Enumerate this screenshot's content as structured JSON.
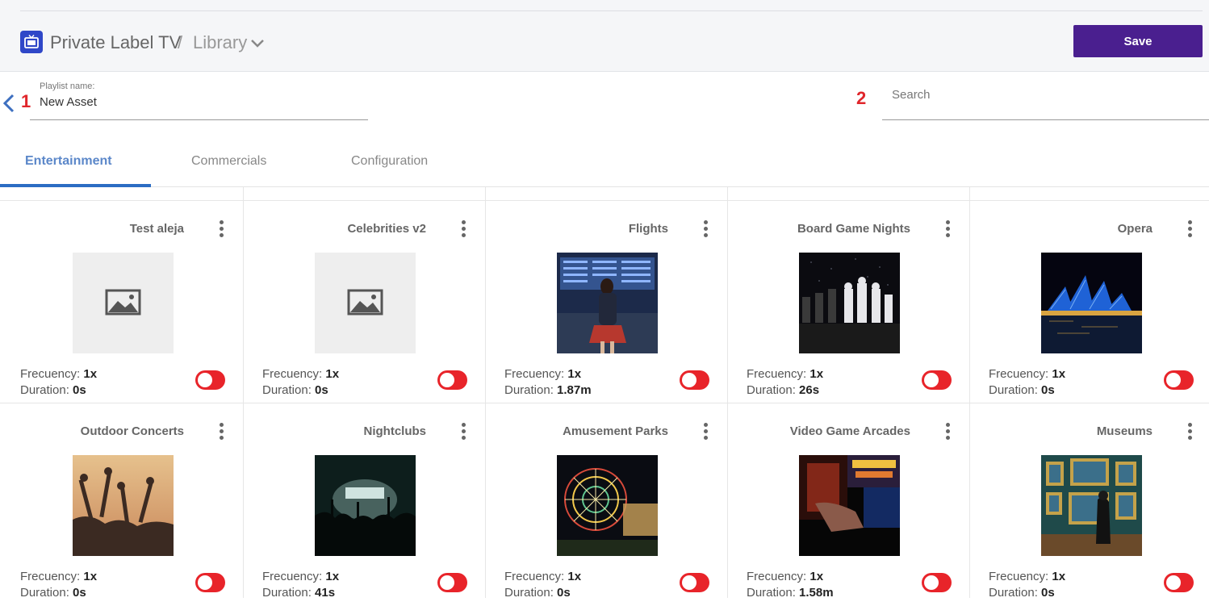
{
  "header": {
    "app_name": "Private Label TV",
    "separator": "/",
    "section": "Library",
    "save_label": "Save",
    "app_icon": "tv-icon",
    "brand_color": "#4a1f8f"
  },
  "playlist": {
    "label": "Playlist name:",
    "value": "New Asset",
    "marker1": "1",
    "marker2": "2",
    "search_placeholder": "Search"
  },
  "tabs": [
    {
      "label": "Entertainment",
      "active": true
    },
    {
      "label": "Commercials",
      "active": false
    },
    {
      "label": "Configuration",
      "active": false
    }
  ],
  "meta_labels": {
    "frequency": "Frecuency:",
    "duration": "Duration:"
  },
  "cards": [
    {
      "title": "Test aleja",
      "frequency": "1x",
      "duration": "0s",
      "thumb": "placeholder",
      "enabled": false
    },
    {
      "title": "Celebrities v2",
      "frequency": "1x",
      "duration": "0s",
      "thumb": "placeholder",
      "enabled": false
    },
    {
      "title": "Flights",
      "frequency": "1x",
      "duration": "1.87m",
      "thumb": "flights",
      "enabled": false
    },
    {
      "title": "Board Game Nights",
      "frequency": "1x",
      "duration": "26s",
      "thumb": "chess",
      "enabled": false
    },
    {
      "title": "Opera",
      "frequency": "1x",
      "duration": "0s",
      "thumb": "opera",
      "enabled": false
    },
    {
      "title": "Outdoor Concerts",
      "frequency": "1x",
      "duration": "0s",
      "thumb": "concert",
      "enabled": false
    },
    {
      "title": "Nightclubs",
      "frequency": "1x",
      "duration": "41s",
      "thumb": "nightclub",
      "enabled": false
    },
    {
      "title": "Amusement Parks",
      "frequency": "1x",
      "duration": "0s",
      "thumb": "ferris",
      "enabled": false
    },
    {
      "title": "Video Game Arcades",
      "frequency": "1x",
      "duration": "1.58m",
      "thumb": "arcade",
      "enabled": false
    },
    {
      "title": "Museums",
      "frequency": "1x",
      "duration": "0s",
      "thumb": "museum",
      "enabled": false
    }
  ]
}
